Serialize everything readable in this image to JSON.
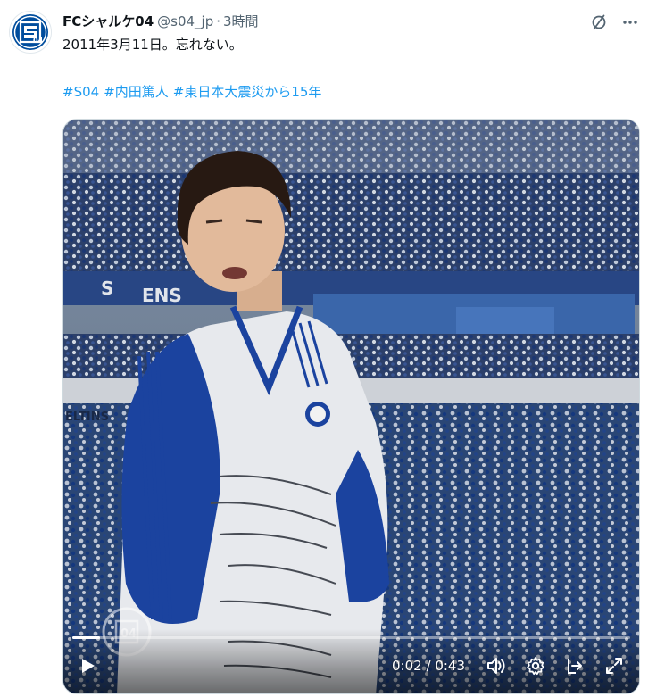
{
  "tweet": {
    "author": {
      "display_name": "FCシャルケ04",
      "handle": "@s04_jp",
      "separator": "·",
      "time": "3時間",
      "avatar_text": "04"
    },
    "text": "2011年3月11日。忘れない。",
    "hashtags": [
      "#S04",
      "#内田篤人",
      "#東日本大震災から15年"
    ],
    "icons": {
      "grok": "grok-slash-icon",
      "more": "more-icon"
    }
  },
  "video": {
    "current_time": "0:02",
    "time_separator": "/",
    "duration": "0:43",
    "progress": 0.05,
    "watermark_text": "04",
    "banner_fragments": [
      "S",
      "ENS",
      "ELTINS"
    ],
    "icons": {
      "play": "play-icon",
      "volume": "volume-icon",
      "settings": "gear-icon",
      "share": "share-icon",
      "fullscreen": "fullscreen-icon"
    }
  },
  "colors": {
    "link": "#1d9bf0",
    "text_primary": "#0f1419",
    "text_secondary": "#536471",
    "schalke_blue": "#004d9d"
  }
}
